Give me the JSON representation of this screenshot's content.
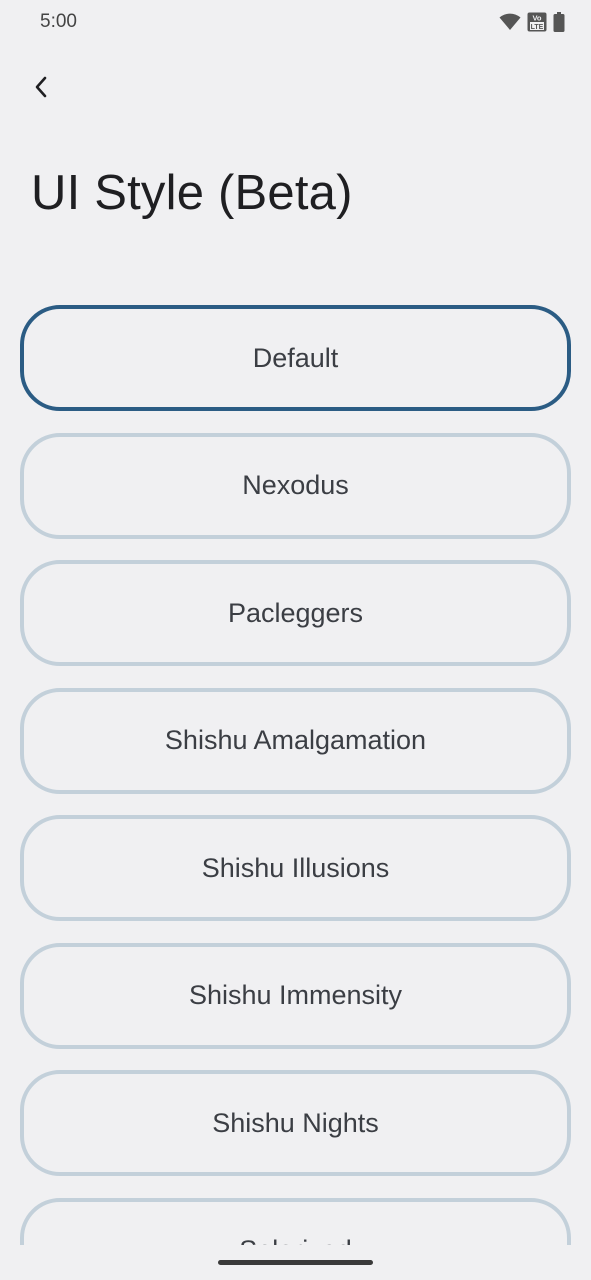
{
  "status_bar": {
    "time": "5:00",
    "icons": [
      "wifi-icon",
      "volte-icon",
      "battery-icon"
    ],
    "volte_top": "Vo",
    "volte_bottom": "LTE"
  },
  "header": {
    "back_icon": "chevron-left-icon",
    "title": "UI Style (Beta)"
  },
  "colors": {
    "background": "#f0f0f2",
    "selected_border": "#2b5c84",
    "unselected_border": "#c3d0da"
  },
  "styles": {
    "selected": "Default",
    "options": [
      {
        "label": "Default"
      },
      {
        "label": "Nexodus"
      },
      {
        "label": "Pacleggers"
      },
      {
        "label": "Shishu Amalgamation"
      },
      {
        "label": "Shishu Illusions"
      },
      {
        "label": "Shishu Immensity"
      },
      {
        "label": "Shishu Nights"
      },
      {
        "label": "Solarized"
      }
    ]
  }
}
